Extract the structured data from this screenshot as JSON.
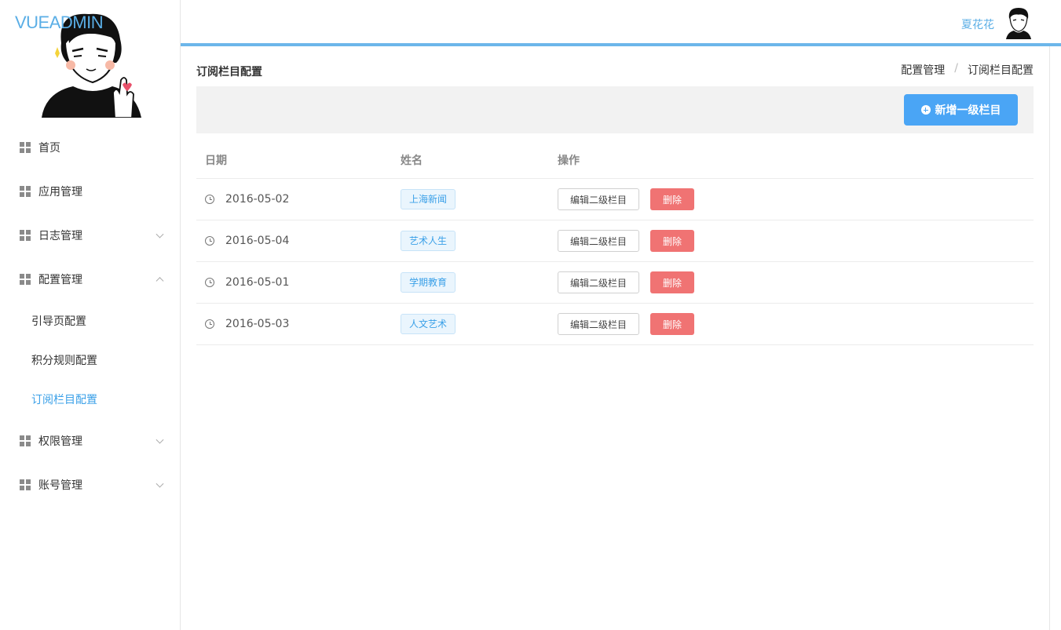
{
  "app": {
    "brand": "VUEADMIN"
  },
  "header": {
    "username": "夏花花"
  },
  "sidebar": {
    "items": [
      {
        "label": "首页",
        "expandable": false
      },
      {
        "label": "应用管理",
        "expandable": false
      },
      {
        "label": "日志管理",
        "expandable": true,
        "expanded": false
      },
      {
        "label": "配置管理",
        "expandable": true,
        "expanded": true,
        "children": [
          {
            "label": "引导页配置",
            "active": false
          },
          {
            "label": "积分规则配置",
            "active": false
          },
          {
            "label": "订阅栏目配置",
            "active": true
          }
        ]
      },
      {
        "label": "权限管理",
        "expandable": true,
        "expanded": false
      },
      {
        "label": "账号管理",
        "expandable": true,
        "expanded": false
      }
    ]
  },
  "page": {
    "title": "订阅栏目配置",
    "breadcrumb": [
      "配置管理",
      "订阅栏目配置"
    ],
    "breadcrumb_separator": "/",
    "add_button": "新增一级栏目"
  },
  "table": {
    "columns": [
      "日期",
      "姓名",
      "操作"
    ],
    "rows": [
      {
        "date": "2016-05-02",
        "name": "上海新闻"
      },
      {
        "date": "2016-05-04",
        "name": "艺术人生"
      },
      {
        "date": "2016-05-01",
        "name": "学期教育"
      },
      {
        "date": "2016-05-03",
        "name": "人文艺术"
      }
    ],
    "edit_label": "编辑二级栏目",
    "delete_label": "删除"
  },
  "colors": {
    "accent": "#4aa5f5",
    "danger": "#f07373",
    "brand": "#5aaee6"
  }
}
